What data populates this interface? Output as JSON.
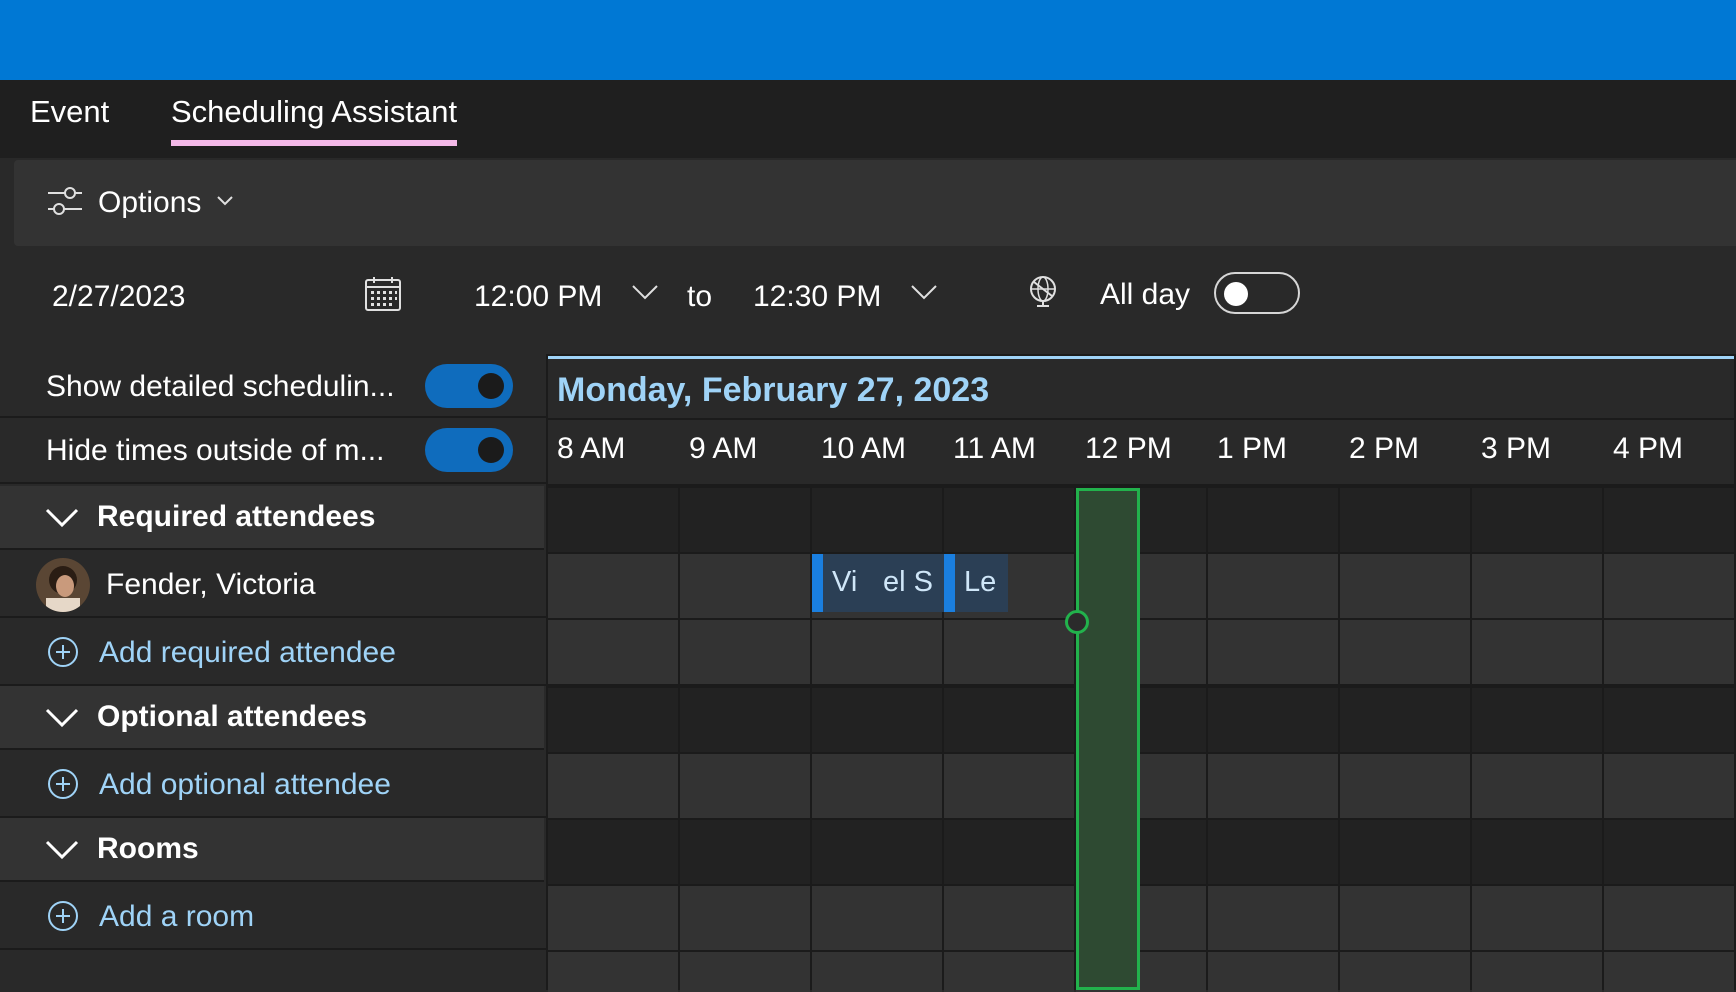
{
  "tabs": [
    {
      "label": "Event",
      "active": false
    },
    {
      "label": "Scheduling Assistant",
      "active": true
    }
  ],
  "options": {
    "label": "Options",
    "icon": "sliders-icon"
  },
  "datebar": {
    "date": "2/27/2023",
    "start_time": "12:00 PM",
    "to_label": "to",
    "end_time": "12:30 PM",
    "all_day_label": "All day",
    "all_day_on": false
  },
  "settings": {
    "show_detailed_label": "Show detailed schedulin...",
    "show_detailed_on": true,
    "hide_times_label": "Hide times outside of m...",
    "hide_times_on": true
  },
  "sections": {
    "required": "Required attendees",
    "optional": "Optional attendees",
    "rooms": "Rooms"
  },
  "attendee": {
    "name": "Fender, Victoria"
  },
  "add_links": {
    "required": "Add required attendee",
    "optional": "Add optional attendee",
    "room": "Add a room"
  },
  "calendar": {
    "date_heading": "Monday, February 27, 2023",
    "hours": [
      "8 AM",
      "9 AM",
      "10 AM",
      "11 AM",
      "12 PM",
      "1 PM",
      "2 PM",
      "3 PM",
      "4 PM"
    ]
  },
  "events": [
    {
      "label": "Vi",
      "label2": "el S"
    },
    {
      "label": "Le"
    }
  ],
  "colors": {
    "accent_bar": "#0078d4",
    "tab_underline": "#f4b9e8",
    "link": "#9fd3f7",
    "selection": "#22b24c",
    "event": "#1a7fe0"
  }
}
